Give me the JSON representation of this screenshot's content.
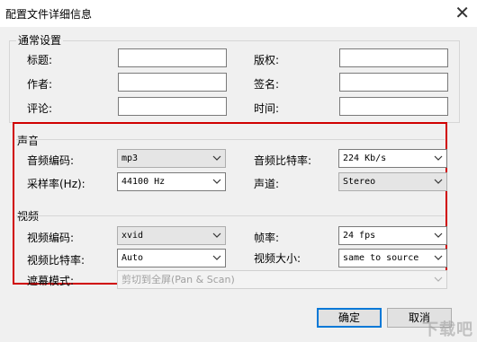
{
  "dialog": {
    "title": "配置文件详细信息",
    "close_glyph": "✕"
  },
  "general": {
    "group_label": "通常设置",
    "title_label": "标题:",
    "copyright_label": "版权:",
    "author_label": "作者:",
    "signature_label": "签名:",
    "comment_label": "评论:",
    "time_label": "时间:",
    "title_value": "",
    "copyright_value": "",
    "author_value": "",
    "signature_value": "",
    "comment_value": "",
    "time_value": ""
  },
  "audio": {
    "group_label": "声音",
    "codec_label": "音频编码:",
    "codec_value": "mp3",
    "bitrate_label": "音频比特率:",
    "bitrate_value": "224 Kb/s",
    "samplerate_label": "采样率(Hz):",
    "samplerate_value": "44100 Hz",
    "channel_label": "声道:",
    "channel_value": "Stereo"
  },
  "video": {
    "group_label": "视频",
    "codec_label": "视频编码:",
    "codec_value": "xvid",
    "framerate_label": "帧率:",
    "framerate_value": "24 fps",
    "bitrate_label": "视频比特率:",
    "bitrate_value": "Auto",
    "size_label": "视频大小:",
    "size_value": "same to source",
    "mask_label": "遮幕模式:",
    "mask_value": "剪切到全屏(Pan & Scan)"
  },
  "buttons": {
    "ok": "确定",
    "cancel": "取消"
  },
  "watermark": "下载吧"
}
